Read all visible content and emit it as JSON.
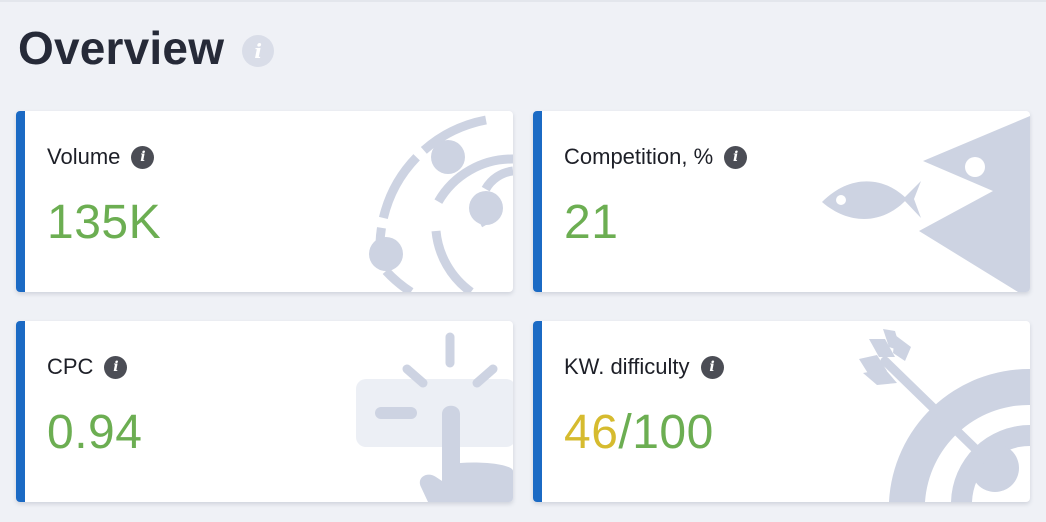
{
  "header": {
    "title": "Overview",
    "info_icon": "info-icon"
  },
  "colors": {
    "background": "#eff1f6",
    "card_accent": "#1b6ac4",
    "value_green": "#6cae52",
    "value_yellow": "#d6bb2f",
    "illustration": "#cdd3e2",
    "info_icon_bg": "#4b4d55"
  },
  "cards": {
    "volume": {
      "label": "Volume",
      "value": "135K",
      "illustration": "orbit-planets-illustration"
    },
    "competition": {
      "label": "Competition, %",
      "value": "21",
      "illustration": "big-fish-eats-small-fish-illustration"
    },
    "cpc": {
      "label": "CPC",
      "value": "0.94",
      "illustration": "hand-click-button-illustration"
    },
    "kw_difficulty": {
      "label": "KW. difficulty",
      "value_part_a": "46",
      "value_part_b": "/100",
      "score": 46,
      "max": 100,
      "illustration": "arrow-in-target-illustration"
    }
  }
}
